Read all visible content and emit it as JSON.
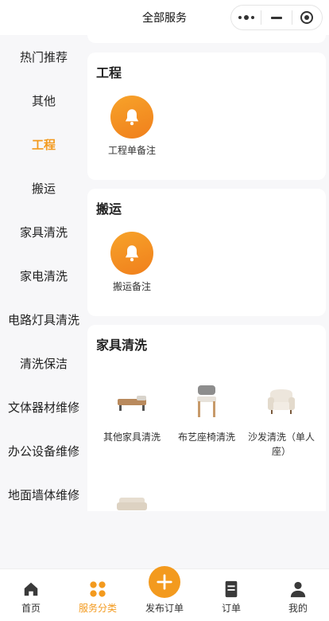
{
  "app": {
    "title": "全部服务"
  },
  "colors": {
    "accent": "#f39a1e",
    "background": "#f7f7f9",
    "card": "#ffffff"
  },
  "capsule": {
    "more_icon": "more-dots-icon",
    "minimize_icon": "minus-icon",
    "close_icon": "target-icon"
  },
  "sidebar": {
    "active_index": 2,
    "items": [
      {
        "label": "热门推荐"
      },
      {
        "label": "其他"
      },
      {
        "label": "工程"
      },
      {
        "label": "搬运"
      },
      {
        "label": "家具清洗"
      },
      {
        "label": "家电清洗"
      },
      {
        "label": "电路灯具清洗"
      },
      {
        "label": "清洗保洁"
      },
      {
        "label": "文体器材维修"
      },
      {
        "label": "办公设备维修"
      },
      {
        "label": "地面墙体维修"
      }
    ]
  },
  "sections": [
    {
      "title": "工程",
      "items": [
        {
          "label": "工程单备注",
          "icon": "bell-icon"
        }
      ]
    },
    {
      "title": "搬运",
      "items": [
        {
          "label": "搬运备注",
          "icon": "bell-icon"
        }
      ]
    },
    {
      "title": "家具清洗",
      "items": [
        {
          "label": "其他家具清洗",
          "icon": "bench-icon"
        },
        {
          "label": "布艺座椅清洗",
          "icon": "chair-icon"
        },
        {
          "label": "沙发清洗（单人座）",
          "icon": "armchair-icon"
        },
        {
          "label": "",
          "icon": "sofa-icon"
        },
        {
          "label": "",
          "icon": "mattress-icon"
        }
      ]
    }
  ],
  "tabbar": {
    "active_index": 1,
    "items": [
      {
        "label": "首页",
        "icon": "home-icon"
      },
      {
        "label": "服务分类",
        "icon": "grid-icon"
      },
      {
        "label": "发布订单",
        "icon": "plus-icon"
      },
      {
        "label": "订单",
        "icon": "document-icon"
      },
      {
        "label": "我的",
        "icon": "user-icon"
      }
    ]
  }
}
